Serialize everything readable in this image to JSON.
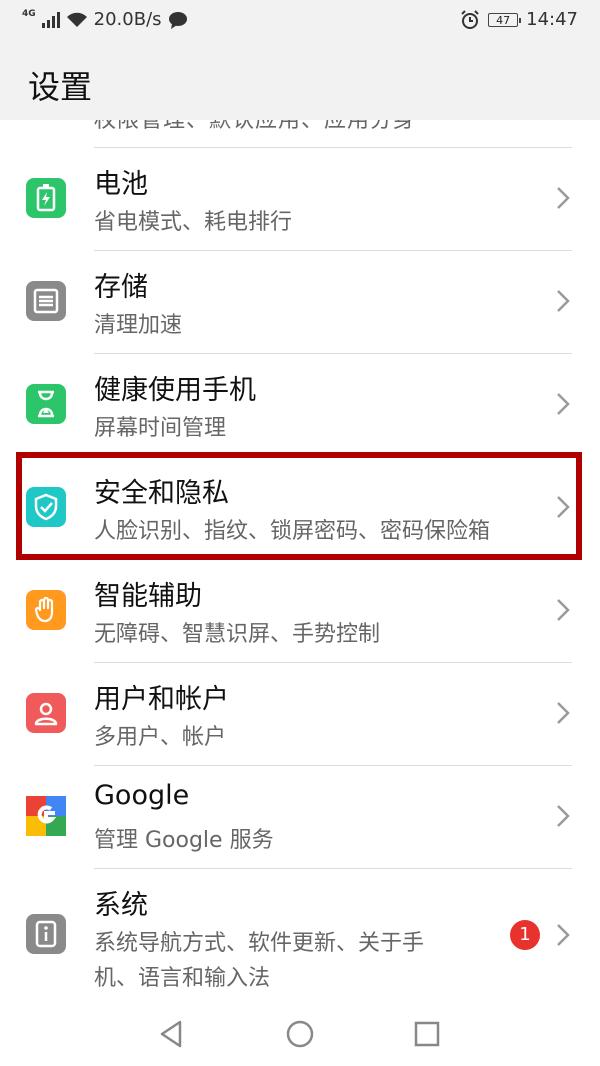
{
  "status_bar": {
    "network": "4G",
    "speed": "20.0B/s",
    "battery": "47",
    "time": "14:47"
  },
  "app_bar": {
    "title": "设置"
  },
  "partial_row_text": "权限管理、默认应用、应用分身",
  "items": [
    {
      "title": "电池",
      "subtitle": "省电模式、耗电排行",
      "icon": "battery-icon",
      "color": "#2dc56a"
    },
    {
      "title": "存储",
      "subtitle": "清理加速",
      "icon": "storage-icon",
      "color": "#8a8a8a"
    },
    {
      "title": "健康使用手机",
      "subtitle": "屏幕时间管理",
      "icon": "hourglass-icon",
      "color": "#2dc56a"
    },
    {
      "title": "安全和隐私",
      "subtitle": "人脸识别、指纹、锁屏密码、密码保险箱",
      "icon": "shield-icon",
      "color": "#1fc7c7"
    },
    {
      "title": "智能辅助",
      "subtitle": "无障碍、智慧识屏、手势控制",
      "icon": "hand-icon",
      "color": "#ff9a1f"
    },
    {
      "title": "用户和帐户",
      "subtitle": "多用户、帐户",
      "icon": "user-icon",
      "color": "#f05a5a"
    },
    {
      "title": "Google",
      "subtitle": "管理 Google 服务",
      "icon": "google-icon",
      "color": "#ffffff"
    },
    {
      "title": "系统",
      "subtitle_line1": "系统导航方式、软件更新、关于手",
      "subtitle_line2": "机、语言和输入法",
      "icon": "system-info-icon",
      "color": "#8a8a8a",
      "badge": "1"
    }
  ],
  "nav": {
    "back": "back-icon",
    "home": "home-icon",
    "recents": "recents-icon"
  }
}
